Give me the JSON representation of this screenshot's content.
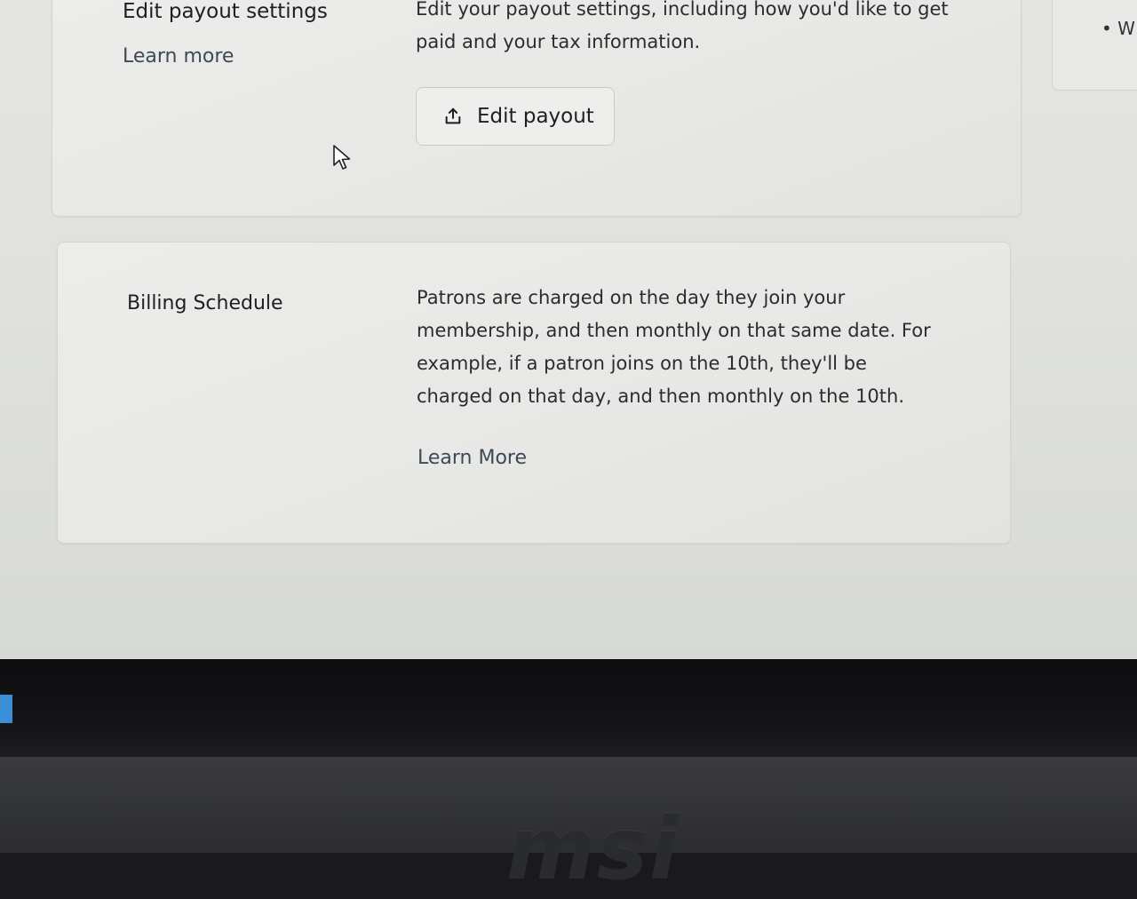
{
  "payout": {
    "title": "Edit payout settings",
    "learn_more": "Learn more",
    "description": "Edit your payout settings, including how you'd like to get paid and your tax information.",
    "button_label": "Edit payout",
    "button_icon": "upload-icon"
  },
  "billing": {
    "title": "Billing Schedule",
    "description": "Patrons are charged on the day they join your membership, and then monthly on that same date. For example, if a patron joins on the 10th, they'll be charged on that day, and then monthly on the 10th.",
    "learn_more": "Learn More"
  },
  "right_panel": {
    "bullet_text": "• W"
  },
  "device": {
    "brand": "msi"
  }
}
